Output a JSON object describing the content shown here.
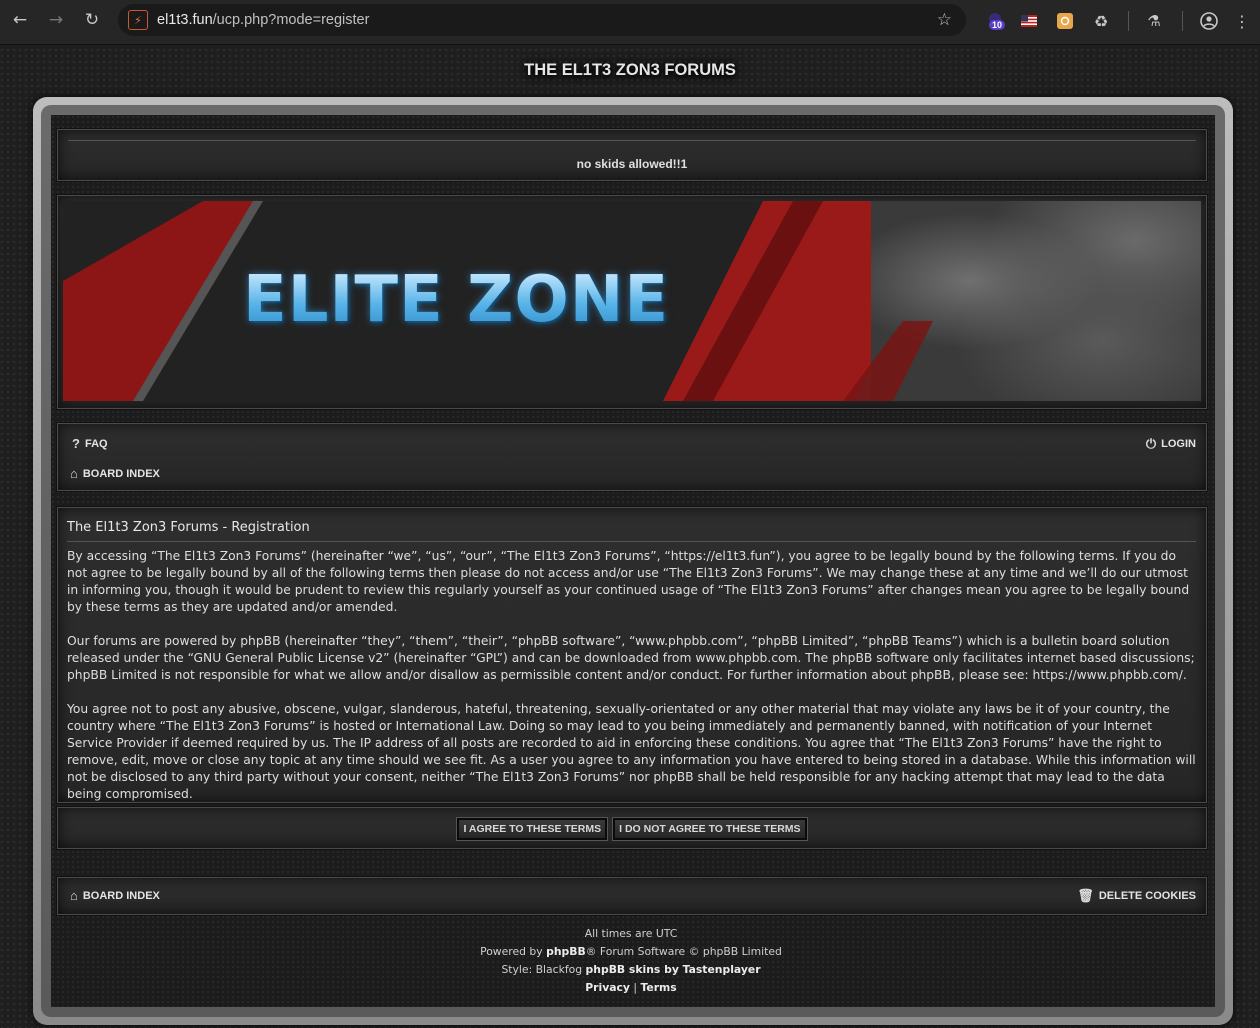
{
  "browser": {
    "url_domain": "el1t3.fun",
    "url_path": "/ucp.php?mode=register",
    "extension_badge": "10"
  },
  "site": {
    "title": "THE EL1T3 ZON3 FORUMS",
    "description": "no skids allowed!!1",
    "banner_text": "ELITE ZONE"
  },
  "nav": {
    "faq": "FAQ",
    "login": "LOGIN",
    "board_index": "BOARD INDEX"
  },
  "registration": {
    "heading": "The El1t3 Zon3 Forums - Registration",
    "paragraphs": [
      "By accessing “The El1t3 Zon3 Forums” (hereinafter “we”, “us”, “our”, “The El1t3 Zon3 Forums”, “https://el1t3.fun”), you agree to be legally bound by the following terms. If you do not agree to be legally bound by all of the following terms then please do not access and/or use “The El1t3 Zon3 Forums”. We may change these at any time and we’ll do our utmost in informing you, though it would be prudent to review this regularly yourself as your continued usage of “The El1t3 Zon3 Forums” after changes mean you agree to be legally bound by these terms as they are updated and/or amended.",
      "Our forums are powered by phpBB (hereinafter “they”, “them”, “their”, “phpBB software”, “www.phpbb.com”, “phpBB Limited”, “phpBB Teams”) which is a bulletin board solution released under the “GNU General Public License v2” (hereinafter “GPL”) and can be downloaded from www.phpbb.com. The phpBB software only facilitates internet based discussions; phpBB Limited is not responsible for what we allow and/or disallow as permissible content and/or conduct. For further information about phpBB, please see: https://www.phpbb.com/.",
      "You agree not to post any abusive, obscene, vulgar, slanderous, hateful, threatening, sexually-orientated or any other material that may violate any laws be it of your country, the country where “The El1t3 Zon3 Forums” is hosted or International Law. Doing so may lead to you being immediately and permanently banned, with notification of your Internet Service Provider if deemed required by us. The IP address of all posts are recorded to aid in enforcing these conditions. You agree that “The El1t3 Zon3 Forums” have the right to remove, edit, move or close any topic at any time should we see fit. As a user you agree to any information you have entered to being stored in a database. While this information will not be disclosed to any third party without your consent, neither “The El1t3 Zon3 Forums” nor phpBB shall be held responsible for any hacking attempt that may lead to the data being compromised."
    ],
    "agree_button": "I AGREE TO THESE TERMS",
    "disagree_button": "I DO NOT AGREE TO THESE TERMS"
  },
  "footer": {
    "board_index": "BOARD INDEX",
    "delete_cookies": "DELETE COOKIES",
    "timezone": "All times are UTC",
    "powered_prefix": "Powered by ",
    "powered_brand": "phpBB",
    "powered_suffix": "® Forum Software © phpBB Limited",
    "style_prefix": "Style: Blackfog ",
    "style_credit": "phpBB skins by Tastenplayer",
    "privacy": "Privacy",
    "separator": "|",
    "terms": "Terms"
  }
}
